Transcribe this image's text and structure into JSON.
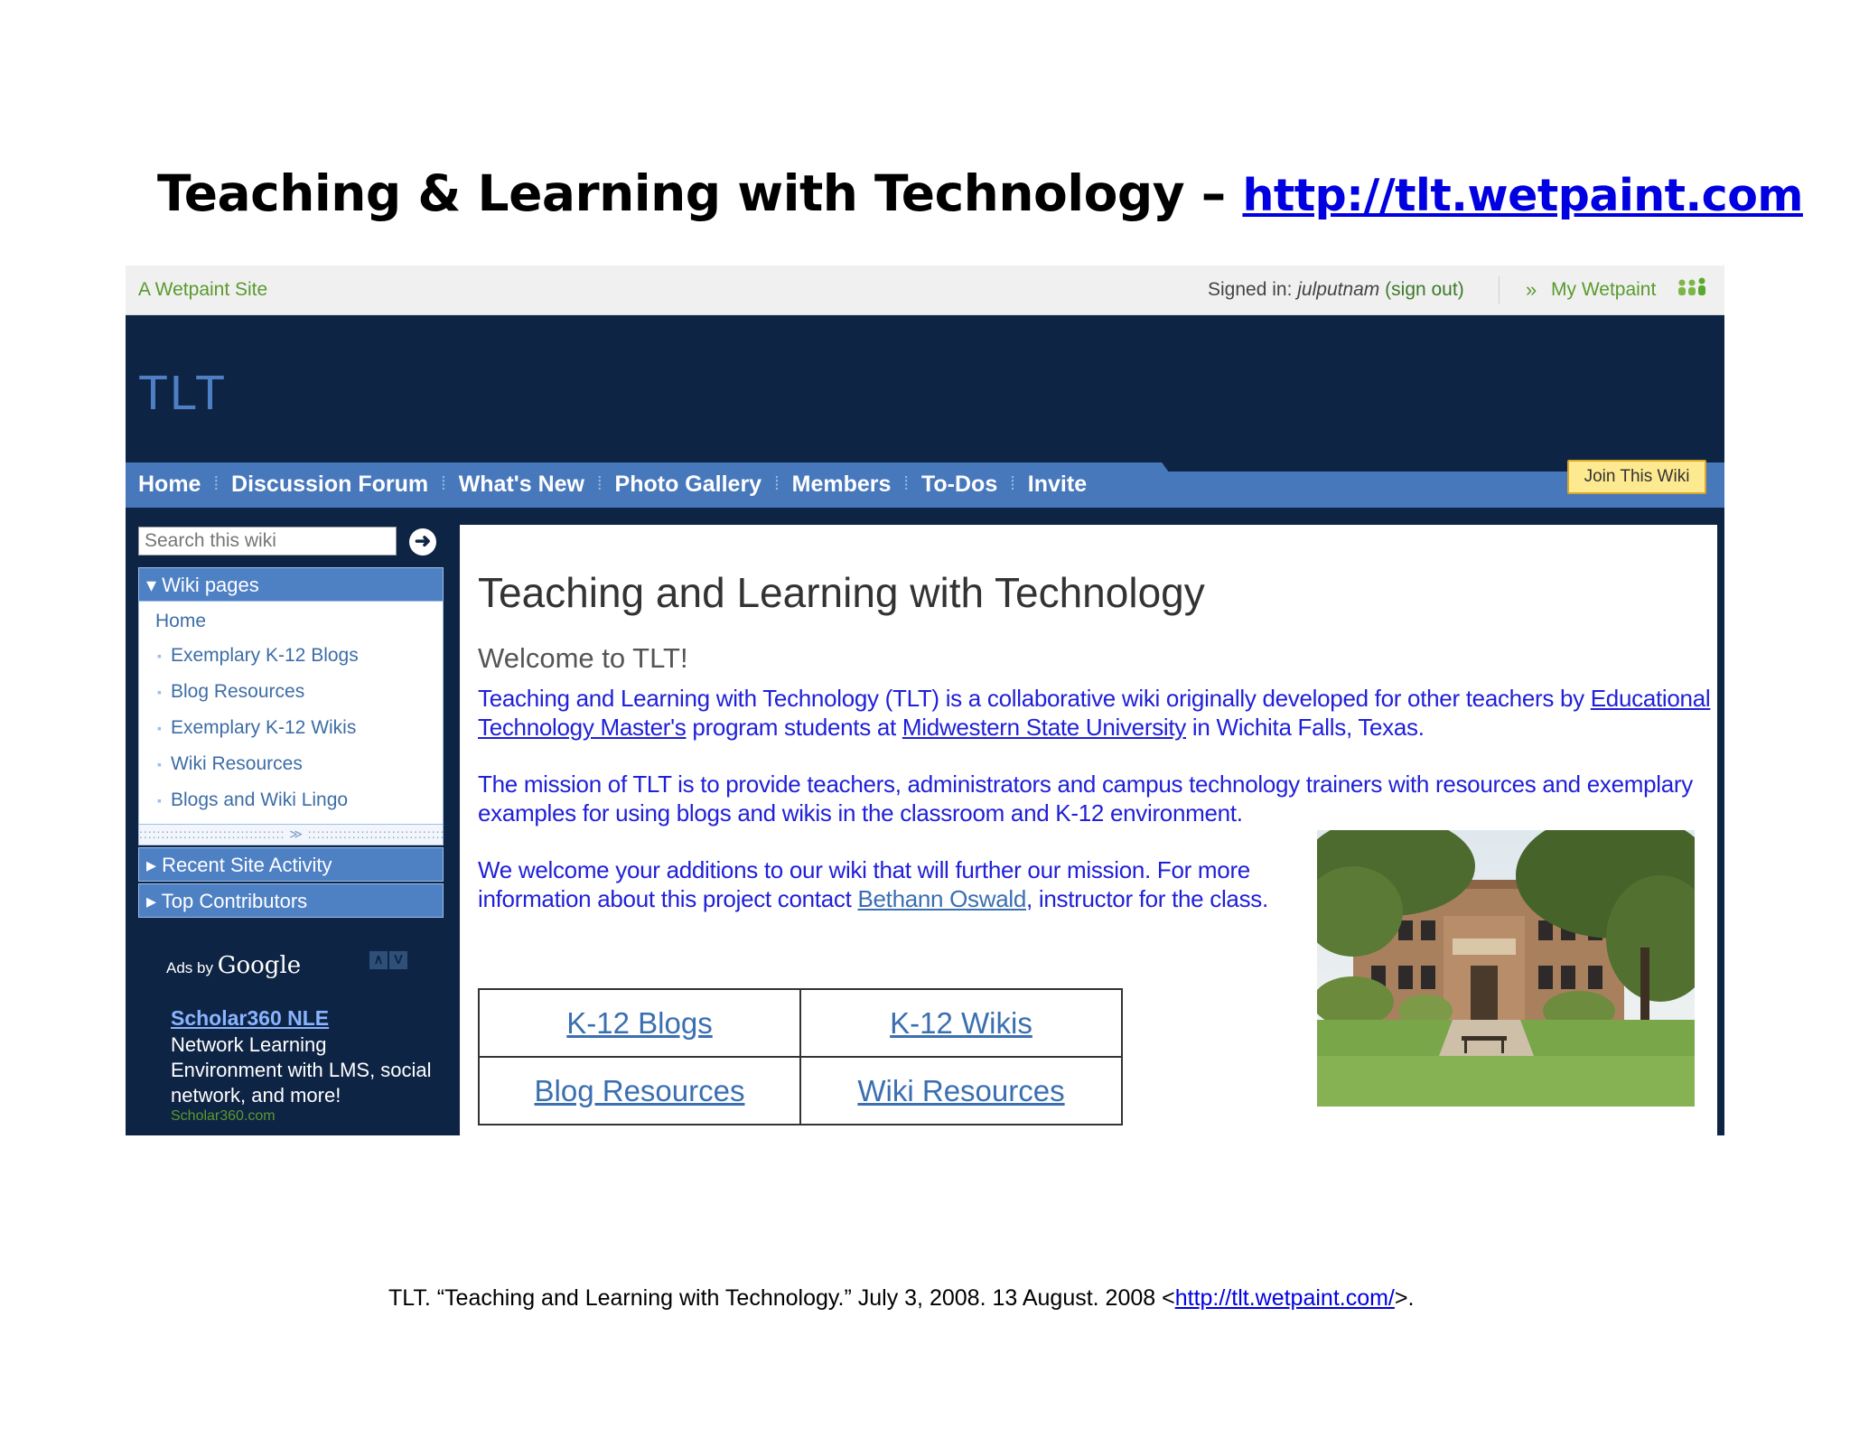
{
  "slide": {
    "title": "Teaching & Learning with Technology –",
    "title_link": "http://tlt.wetpaint.com",
    "citation_prefix": "TLT.  “Teaching and Learning with Technology.” July 3, 2008. 13 August. 2008 <",
    "citation_link": "http://tlt.wetpaint.com/",
    "citation_suffix": ">."
  },
  "topbar": {
    "site_label": "A Wetpaint Site",
    "signed_in_label": "Signed in:",
    "username": "julputnam",
    "sign_out": "(sign out)",
    "arrow": "»",
    "my_wetpaint": "My Wetpaint"
  },
  "brand": "TLT",
  "nav": {
    "items": [
      "Home",
      "Discussion Forum",
      "What's New",
      "Photo Gallery",
      "Members",
      "To-Dos",
      "Invite"
    ],
    "join": "Join This Wiki"
  },
  "search": {
    "placeholder": "Search this wiki",
    "go": "➜"
  },
  "sidebar": {
    "wiki_pages": "Wiki pages",
    "home": "Home",
    "pages": [
      "Exemplary K-12 Blogs",
      "Blog Resources",
      "Exemplary K-12 Wikis",
      "Wiki Resources",
      "Blogs and Wiki Lingo"
    ],
    "grip": "::::::::::::::::::::::::::::::::: ≫ :::::::::::::::::::::::::::::::::",
    "recent_activity": "Recent Site Activity",
    "top_contributors": "Top Contributors"
  },
  "ads": {
    "label": "Ads by",
    "google": "Google",
    "prev": "∧",
    "next": "V",
    "title": "Scholar360 NLE",
    "text": "Network Learning Environment with LMS, social network, and more!",
    "url": "Scholar360.com"
  },
  "content": {
    "title": "Teaching and Learning with Technology",
    "welcome": "Welcome to TLT!",
    "p1_a": "Teaching and Learning with Technology (TLT) is a collaborative wiki originally developed for other teachers by ",
    "p1_link1": "Educational Technology Master's",
    "p1_b": " program students at ",
    "p1_link2": "Midwestern State University",
    "p1_c": " in Wichita Falls, Texas.",
    "p2": "The mission of TLT is to provide teachers, administrators and campus technology trainers with resources and exemplary examples for using blogs and wikis in the classroom and K-12 environment.",
    "p3_a": "We welcome your additions to our wiki that will further our mission. For more information about this project contact ",
    "p3_link": "Bethann Oswald",
    "p3_b": ", instructor for the class.",
    "table": [
      [
        "K-12 Blogs",
        "K-12 Wikis"
      ],
      [
        "Blog Resources",
        "Wiki Resources"
      ]
    ]
  },
  "colors": {
    "header_navy": "#0e2444",
    "nav_blue": "#4878bc",
    "brand_blue": "#4d7fc4",
    "text_blue": "#2020d8",
    "link_blue": "#3a6fb0",
    "wetpaint_green": "#5a9a2e",
    "join_yellow": "#fde98f"
  }
}
